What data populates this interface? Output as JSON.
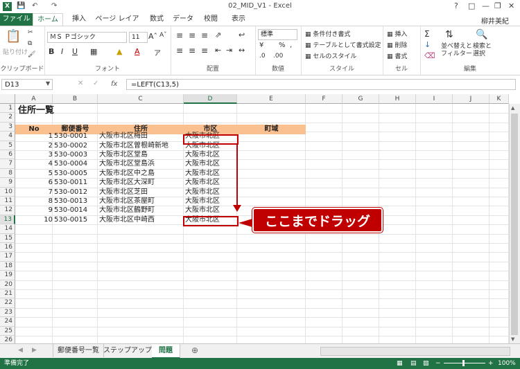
{
  "window": {
    "title": "02_MID_V1 - Excel",
    "qat": [
      "save-icon",
      "undo-icon",
      "redo-icon"
    ]
  },
  "user": "柳井美紀",
  "tabs": [
    "ファイル",
    "ホーム",
    "挿入",
    "ページ レイアウト",
    "数式",
    "データ",
    "校閲",
    "表示"
  ],
  "ribbon": {
    "clipboard": {
      "paste": "貼り付け",
      "label": "クリップボード"
    },
    "font": {
      "name": "ＭＳ Ｐゴシック",
      "size": "11",
      "label": "フォント"
    },
    "align": {
      "label": "配置"
    },
    "number": {
      "format": "標準",
      "label": "数値"
    },
    "styles": {
      "cond": "条件付き書式",
      "table": "テーブルとして書式設定",
      "cell": "セルのスタイル",
      "label": "スタイル"
    },
    "cells": {
      "insert": "挿入",
      "delete": "削除",
      "format": "書式",
      "label": "セル"
    },
    "edit": {
      "sort": "並べ替えと\nフィルター",
      "find": "検索と\n選択",
      "label": "編集"
    }
  },
  "formula": {
    "namebox": "D13",
    "fx": "fx",
    "content": "=LEFT(C13,5)"
  },
  "columns": [
    "A",
    "B",
    "C",
    "D",
    "E",
    "F",
    "G",
    "H",
    "I",
    "J",
    "K"
  ],
  "sheet": {
    "title": "住所一覧",
    "headers": {
      "no": "No",
      "zip": "郵便番号",
      "addr": "住所",
      "city": "市区",
      "town": "町域"
    },
    "rows": [
      {
        "no": "1",
        "zip": "530-0001",
        "addr": "大阪市北区梅田",
        "city": "大阪市北区"
      },
      {
        "no": "2",
        "zip": "530-0002",
        "addr": "大阪市北区曽根崎新地",
        "city": "大阪市北区"
      },
      {
        "no": "3",
        "zip": "530-0003",
        "addr": "大阪市北区堂島",
        "city": "大阪市北区"
      },
      {
        "no": "4",
        "zip": "530-0004",
        "addr": "大阪市北区堂島浜",
        "city": "大阪市北区"
      },
      {
        "no": "5",
        "zip": "530-0005",
        "addr": "大阪市北区中之島",
        "city": "大阪市北区"
      },
      {
        "no": "6",
        "zip": "530-0011",
        "addr": "大阪市北区大深町",
        "city": "大阪市北区"
      },
      {
        "no": "7",
        "zip": "530-0012",
        "addr": "大阪市北区芝田",
        "city": "大阪市北区"
      },
      {
        "no": "8",
        "zip": "530-0013",
        "addr": "大阪市北区茶屋町",
        "city": "大阪市北区"
      },
      {
        "no": "9",
        "zip": "530-0014",
        "addr": "大阪市北区鶴野町",
        "city": "大阪市北区"
      },
      {
        "no": "10",
        "zip": "530-0015",
        "addr": "大阪市北区中崎西",
        "city": "大阪市北区"
      }
    ]
  },
  "callout": "ここまでドラッグ",
  "sheettabs": [
    "郵便番号一覧",
    "ステップアップ",
    "問題"
  ],
  "status": {
    "left": "準備完了",
    "zoom": "100%"
  },
  "colors": {
    "excel_green": "#217346",
    "header_fill": "#fac090",
    "annotation_red": "#c00000"
  }
}
